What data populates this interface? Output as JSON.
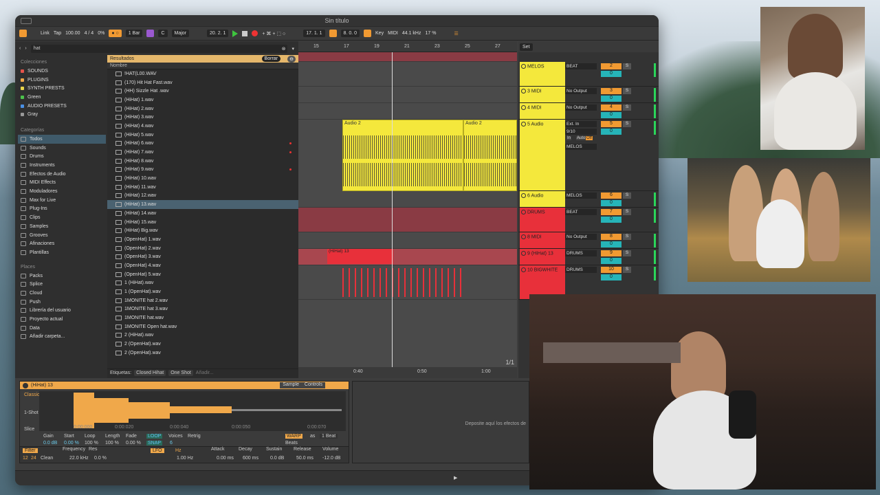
{
  "window": {
    "title": "Sin título"
  },
  "control_bar": {
    "link": "Link",
    "tap": "Tap",
    "bpm": "100.00",
    "meter": "4 / 4",
    "pct": "0%",
    "quant": "1 Bar",
    "key": "C",
    "scale": "Major",
    "position": "20. 2. 1",
    "loop_start": "17. 1. 1",
    "loop_len": "8. 0. 0",
    "key_btn": "Key",
    "midi_btn": "MIDI",
    "sample_rate": "44.1 kHz",
    "cpu": "17 %"
  },
  "browser": {
    "search": "hat",
    "collections_header": "Colecciones",
    "collections": [
      {
        "label": "SOUNDS",
        "color": "#e5534b"
      },
      {
        "label": "PLUGINS",
        "color": "#f0a84a"
      },
      {
        "label": "SYNTH PRESTS",
        "color": "#e9d44a"
      },
      {
        "label": "Green",
        "color": "#4cc24c"
      },
      {
        "label": "AUDIO PRESETS",
        "color": "#4a90e5"
      },
      {
        "label": "Gray",
        "color": "#999999"
      }
    ],
    "categories_header": "Categorías",
    "categories": [
      "Todos",
      "Sounds",
      "Drums",
      "Instruments",
      "Efectos de Audio",
      "MIDI Effects",
      "Moduladores",
      "Max for Live",
      "Plug-Ins",
      "Clips",
      "Samples",
      "Grooves",
      "Afinaciones",
      "Plantillas"
    ],
    "places_header": "Places",
    "places": [
      "Packs",
      "Splice",
      "Cloud",
      "Push",
      "Librería del usuario",
      "Proyecto actual",
      "Data",
      "Añadir carpeta..."
    ],
    "results_label": "Resultados",
    "clear_btn": "Borrar",
    "column": "Nombre",
    "files": [
      "!HAT(L00.WAV",
      "(170) Hit Hat Fast.wav",
      "(HH) Sizzle Hat .wav",
      "(HiHat) 1.wav",
      "(HiHat) 2.wav",
      "(HiHat) 3.wav",
      "(HiHat) 4.wav",
      "(HiHat) 5.wav",
      "(HiHat) 6.wav",
      "(HiHat) 7.wav",
      "(HiHat) 8.wav",
      "(HiHat) 9.wav",
      "(HiHat) 10.wav",
      "(HiHat) 11.wav",
      "(HiHat) 12.wav",
      "(HiHat) 13.wav",
      "(HiHat) 14.wav",
      "(HiHat) 15.wav",
      "(HiHat) Big.wav",
      "(OpenHat) 1.wav",
      "(OpenHat) 2.wav",
      "(OpenHat) 3.wav",
      "(OpenHat) 4.wav",
      "(OpenHat) 5.wav",
      "1 (HiHat).wav",
      "1 (OpenHat).wav",
      "1MONITE hat 2.wav",
      "1MONITE hat 3.wav",
      "1MONITE hat.wav",
      "1MONITE Open hat.wav",
      "2 (HiHat).wav",
      "2 (OpenHat).wav",
      "2 (OpenHat).wav"
    ],
    "tags_label": "Etiquetas:",
    "tags": [
      "Closed Hihat",
      "One Shot"
    ],
    "tag_add": "Añadir..."
  },
  "arrangement": {
    "ruler": [
      "15",
      "17",
      "19",
      "21",
      "23",
      "25",
      "27"
    ],
    "time_ruler": [
      "0:40",
      "0:50",
      "1:00"
    ],
    "clip_label": "Audio 2",
    "hihat_clip": "(HiHat) 13",
    "page": "1/1",
    "set_btn": "Set"
  },
  "tracks": [
    {
      "name": "MELOS",
      "in": "BEAT",
      "num": "2",
      "color": "#f4e83c"
    },
    {
      "name": "3 MIDI",
      "in": "No Output",
      "num": "3",
      "color": "#f4e83c"
    },
    {
      "name": "4 MIDI",
      "in": "No Output",
      "num": "4",
      "color": "#f4e83c"
    },
    {
      "name": "5 Audio",
      "in": "Ext. In",
      "num": "5",
      "color": "#f4e83c",
      "extra1": "9/10",
      "extra2": "MELOS",
      "mon": [
        "In",
        "Auto",
        "Off"
      ]
    },
    {
      "name": "6 Audio",
      "in": "MELOS",
      "num": "6",
      "color": "#f4e83c"
    },
    {
      "name": "DRUMS",
      "in": "BEAT",
      "num": "7",
      "color": "#e8303a"
    },
    {
      "name": "8 MIDI",
      "in": "No Output",
      "num": "8",
      "color": "#e8303a"
    },
    {
      "name": "9 (HiHat) 13",
      "in": "DRUMS",
      "num": "9",
      "color": "#e8303a"
    },
    {
      "name": "10 BIGWHITE",
      "in": "DRUMS",
      "num": "10",
      "color": "#e8303a"
    }
  ],
  "detail": {
    "title": "(HiHat) 13",
    "tab_sample": "Sample",
    "tab_controls": "Controls",
    "mode": "Classic",
    "shot": "1-Shot",
    "slice": "Slice",
    "times": [
      "0:00:000",
      "0:00:020",
      "0:00:040",
      "0:00:050",
      "0:00:070"
    ],
    "gain_l": "Gain",
    "gain": "0.0 dB",
    "start_l": "Start",
    "start": "0.00 %",
    "loop_l": "Loop",
    "loop": "100 %",
    "length_l": "Length",
    "length": "100 %",
    "fade_l": "Fade",
    "fade": "0.00 %",
    "loop_btn": "LOOP",
    "snap_btn": "SNAP",
    "voices_l": "Voices",
    "voices": "6",
    "retrig_l": "Retrig",
    "warp_btn": "WARP",
    "as_l": "as",
    "beat_btn": "1 Beat",
    "beats": "Beats",
    "filter_l": "Filter",
    "freq_l": "Frequency",
    "res_l": "Res",
    "f12": "12",
    "f24": "24",
    "clean": "Clean",
    "freq": "22.0 kHz",
    "res": "0.0 %",
    "lfo": "LFO",
    "hz": "Hz",
    "lfo_rate": "1.00 Hz",
    "attack_l": "Attack",
    "attack": "0.00 ms",
    "decay_l": "Decay",
    "decay": "600 ms",
    "sustain_l": "Sustain",
    "sustain": "0.0 dB",
    "release_l": "Release",
    "release": "50.0 ms",
    "volume_l": "Volume",
    "volume": "-12.0 dB"
  },
  "drop_text": "Deposite aquí los efectos de"
}
